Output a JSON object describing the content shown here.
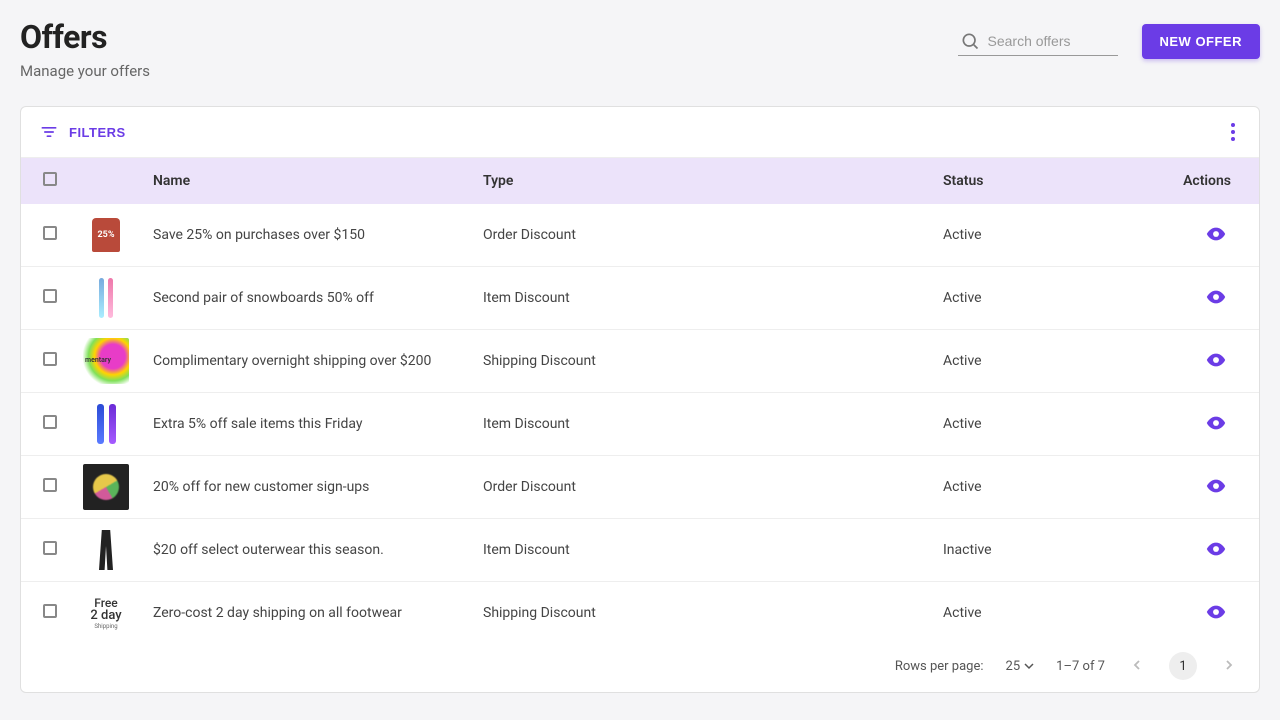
{
  "header": {
    "title": "Offers",
    "subtitle": "Manage your offers",
    "search_placeholder": "Search offers",
    "new_offer_label": "NEW OFFER"
  },
  "toolbar": {
    "filters_label": "FILTERS"
  },
  "columns": {
    "name": "Name",
    "type": "Type",
    "status": "Status",
    "actions": "Actions"
  },
  "rows": [
    {
      "name": "Save 25% on purchases over $150",
      "type": "Order Discount",
      "status": "Active",
      "thumb": "tag"
    },
    {
      "name": "Second pair of snowboards 50% off",
      "type": "Item Discount",
      "status": "Active",
      "thumb": "boards"
    },
    {
      "name": "Complimentary overnight shipping over $200",
      "type": "Shipping Discount",
      "status": "Active",
      "thumb": "splash"
    },
    {
      "name": "Extra 5% off sale items this Friday",
      "type": "Item Discount",
      "status": "Active",
      "thumb": "boards2"
    },
    {
      "name": "20% off for new customer sign-ups",
      "type": "Order Discount",
      "status": "Active",
      "thumb": "flower"
    },
    {
      "name": "$20 off select outerwear this season.",
      "type": "Item Discount",
      "status": "Inactive",
      "thumb": "pants"
    },
    {
      "name": "Zero-cost 2 day shipping on all footwear",
      "type": "Shipping Discount",
      "status": "Active",
      "thumb": "free"
    }
  ],
  "pagination": {
    "rows_label": "Rows per page:",
    "rows_value": "25",
    "range": "1–7 of 7",
    "page": "1"
  },
  "free_thumb": {
    "l1": "Free",
    "l2": "2 day",
    "l3": "Shipping"
  }
}
